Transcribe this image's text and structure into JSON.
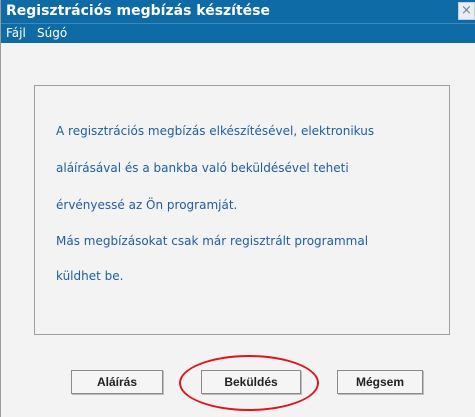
{
  "window": {
    "title": "Regisztrációs megbízás készítése",
    "close_symbol": "×"
  },
  "menu": {
    "items": [
      {
        "label": "Fájl"
      },
      {
        "label": "Súgó"
      }
    ]
  },
  "content": {
    "lines": [
      "A regisztrációs megbízás elkészítésével, elektronikus",
      "aláírásával és a bankba való beküldésével teheti",
      "érvényessé az Ön programját.",
      "Más megbízásokat csak már regisztrált programmal",
      "küldhet be."
    ]
  },
  "buttons": {
    "sign_label": "Aláírás",
    "send_label": "Beküldés",
    "cancel_label": "Mégsem"
  },
  "colors": {
    "titlebar": "#0f6ba6",
    "info_text": "#1f5fa0",
    "highlight": "#e0141b"
  }
}
